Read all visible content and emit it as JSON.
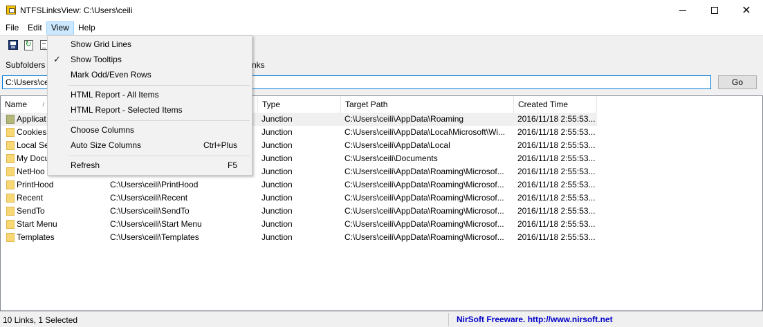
{
  "window": {
    "title": "NTFSLinksView:  C:\\Users\\ceili",
    "app_icon": "app-icon",
    "controls": {
      "minimize": "minimize-icon",
      "maximize": "maximize-icon",
      "close_glyph": "✕"
    }
  },
  "menubar": {
    "file": "File",
    "edit": "Edit",
    "view": "View",
    "help": "Help"
  },
  "toolbar": {
    "icons": [
      "save-icon",
      "refresh-icon",
      "properties-icon"
    ]
  },
  "options": {
    "subfolders_label": "Subfolders d",
    "links_label": "nks"
  },
  "path": {
    "value": "C:\\Users\\ceili",
    "go_label": "Go"
  },
  "columns": {
    "name": "Name",
    "sort_glyph": "/",
    "type": "Type",
    "target": "Target Path",
    "created": "Created Time"
  },
  "rows": [
    {
      "name": "Applicat",
      "path": "",
      "type": "Junction",
      "target": "C:\\Users\\ceili\\AppData\\Roaming",
      "created": "2016/11/18 2:55:53..."
    },
    {
      "name": "Cookies",
      "path": "",
      "type": "Junction",
      "target": "C:\\Users\\ceili\\AppData\\Local\\Microsoft\\Wi...",
      "created": "2016/11/18 2:55:53..."
    },
    {
      "name": "Local Se",
      "path": "",
      "type": "Junction",
      "target": "C:\\Users\\ceili\\AppData\\Local",
      "created": "2016/11/18 2:55:53..."
    },
    {
      "name": "My Docu",
      "path": "",
      "type": "Junction",
      "target": "C:\\Users\\ceili\\Documents",
      "created": "2016/11/18 2:55:53..."
    },
    {
      "name": "NetHoo",
      "path": "",
      "type": "Junction",
      "target": "C:\\Users\\ceili\\AppData\\Roaming\\Microsof...",
      "created": "2016/11/18 2:55:53..."
    },
    {
      "name": "PrintHood",
      "path": "C:\\Users\\ceili\\PrintHood",
      "type": "Junction",
      "target": "C:\\Users\\ceili\\AppData\\Roaming\\Microsof...",
      "created": "2016/11/18 2:55:53..."
    },
    {
      "name": "Recent",
      "path": "C:\\Users\\ceili\\Recent",
      "type": "Junction",
      "target": "C:\\Users\\ceili\\AppData\\Roaming\\Microsof...",
      "created": "2016/11/18 2:55:53..."
    },
    {
      "name": "SendTo",
      "path": "C:\\Users\\ceili\\SendTo",
      "type": "Junction",
      "target": "C:\\Users\\ceili\\AppData\\Roaming\\Microsof...",
      "created": "2016/11/18 2:55:53..."
    },
    {
      "name": "Start Menu",
      "path": "C:\\Users\\ceili\\Start Menu",
      "type": "Junction",
      "target": "C:\\Users\\ceili\\AppData\\Roaming\\Microsof...",
      "created": "2016/11/18 2:55:53..."
    },
    {
      "name": "Templates",
      "path": "C:\\Users\\ceili\\Templates",
      "type": "Junction",
      "target": "C:\\Users\\ceili\\AppData\\Roaming\\Microsof...",
      "created": "2016/11/18 2:55:53..."
    }
  ],
  "view_menu": {
    "show_grid_lines": "Show Grid Lines",
    "show_tooltips": "Show Tooltips",
    "check_glyph": "✓",
    "mark_odd_even": "Mark Odd/Even Rows",
    "html_report_all": "HTML Report - All Items",
    "html_report_selected": "HTML Report - Selected Items",
    "choose_columns": "Choose Columns",
    "auto_size_columns": "Auto Size Columns",
    "auto_size_shortcut": "Ctrl+Plus",
    "refresh": "Refresh",
    "refresh_shortcut": "F5"
  },
  "statusbar": {
    "count": "10 Links, 1 Selected",
    "freeware": "NirSoft Freeware.  http://www.nirsoft.net"
  },
  "colors": {
    "accent": "#0078d7",
    "menu_highlight": "#91c9f7",
    "status_link": "#0000c8"
  }
}
